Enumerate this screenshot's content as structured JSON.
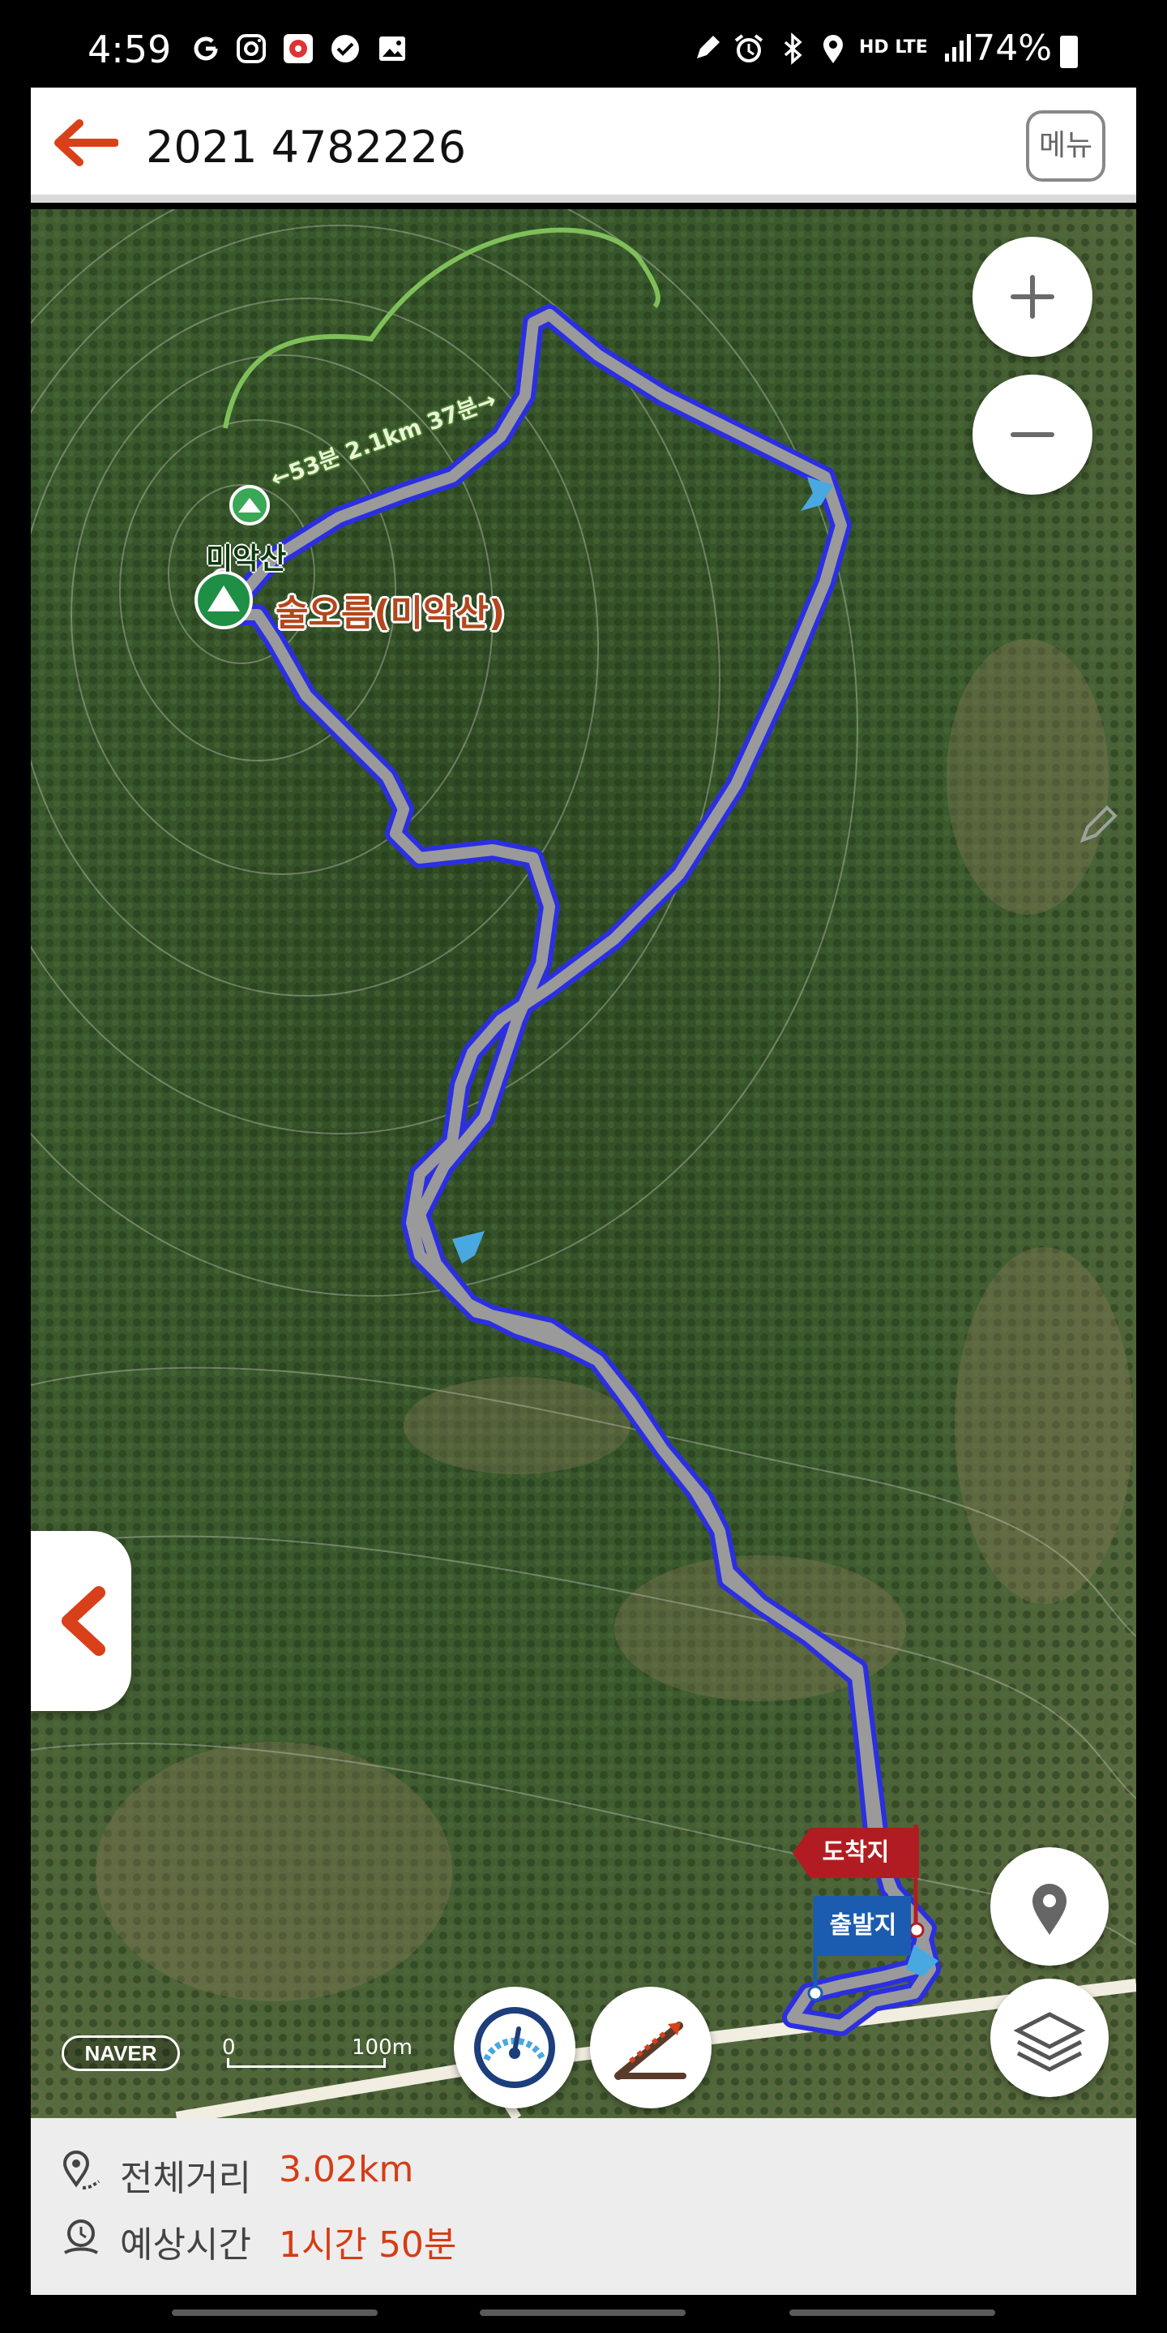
{
  "status_bar": {
    "time": "4:59",
    "battery": "74%",
    "network": "HD LTE",
    "icons": [
      "g-icon",
      "instagram-icon",
      "app-icon",
      "check-icon",
      "image-icon",
      "pen-icon",
      "alarm-icon",
      "bluetooth-icon",
      "location-icon",
      "signal-icon",
      "battery-icon"
    ]
  },
  "header": {
    "title": "2021 4782226",
    "menu_label": "메뉴",
    "accent_color": "#d9401a"
  },
  "map": {
    "provider": "NAVER",
    "scale_zero": "0",
    "scale_label": "100m",
    "peak_label": "술오름(미악산)",
    "peak_small_label": "미악산",
    "trail_time_label": "←53분 2.1km 37분→",
    "arrival_label": "도착지",
    "departure_label": "출발지",
    "route_color": "#2b2fe0",
    "route_core_color": "#9a9a9a"
  },
  "controls": {
    "zoom_in": "+",
    "zoom_out": "−"
  },
  "info": {
    "distance_label": "전체거리",
    "distance_value": "3.02km",
    "time_label": "예상시간",
    "time_value": "1시간 50분"
  }
}
